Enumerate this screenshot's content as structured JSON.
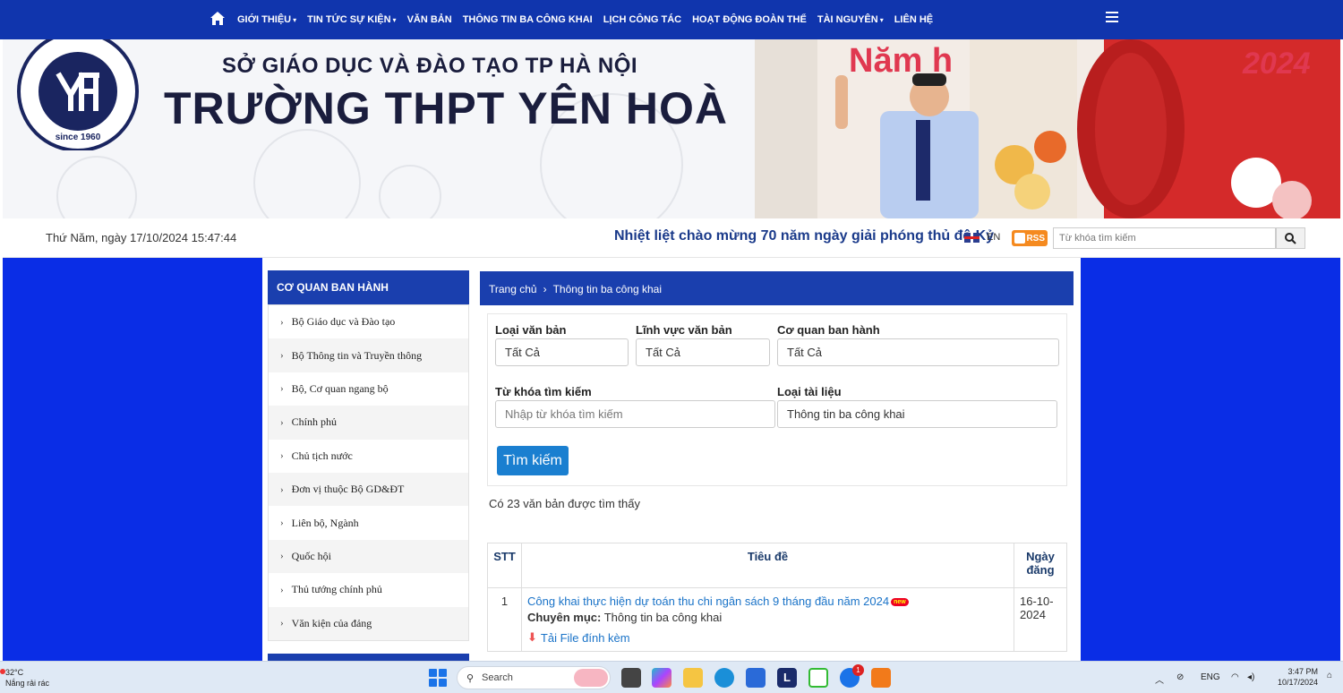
{
  "nav": {
    "items": [
      {
        "label": "GIỚI THIỆU",
        "dropdown": true
      },
      {
        "label": "TIN TỨC SỰ KIỆN",
        "dropdown": true
      },
      {
        "label": "VĂN BẢN",
        "dropdown": false
      },
      {
        "label": "THÔNG TIN BA CÔNG KHAI",
        "dropdown": false
      },
      {
        "label": "LỊCH CÔNG TÁC",
        "dropdown": false
      },
      {
        "label": "HOẠT ĐỘNG ĐOÀN THỂ",
        "dropdown": false
      },
      {
        "label": "TÀI NGUYÊN",
        "dropdown": true
      },
      {
        "label": "LIÊN HỆ",
        "dropdown": false
      }
    ]
  },
  "banner": {
    "subtitle": "SỞ GIÁO DỤC VÀ ĐÀO TẠO TP HÀ NỘI",
    "title": "TRƯỜNG THPT YÊN HOÀ",
    "logo_text": "TRƯỜNG THPT YÊN HOÀ",
    "logo_since": "since 1960",
    "photo_caption": "Năm học",
    "photo_year": "2024"
  },
  "infobar": {
    "datetime": "Thứ Năm, ngày 17/10/2024 15:47:44",
    "marquee": "Nhiệt liệt chào mừng 70 năm ngày giải phóng thủ đô Kỷ",
    "lang": "EN",
    "rss": "RSS",
    "search_placeholder": "Từ khóa tìm kiếm"
  },
  "sidebar": {
    "title": "CƠ QUAN BAN HÀNH",
    "items": [
      "Bộ Giáo dục và Đào tạo",
      "Bộ Thông tin và Truyền thông",
      "Bộ, Cơ quan ngang bộ",
      "Chính phủ",
      "Chủ tịch nước",
      "Đơn vị thuộc Bộ GD&ĐT",
      "Liên bộ, Ngành",
      "Quốc hội",
      "Thủ tướng chính phủ",
      "Văn kiện của đảng"
    ]
  },
  "breadcrumb": {
    "home": "Trang chủ",
    "current": "Thông tin ba công khai"
  },
  "filter": {
    "doc_type_label": "Loại văn bản",
    "doc_type_value": "Tất Cả",
    "field_label": "Lĩnh vực văn bản",
    "field_value": "Tất Cả",
    "agency_label": "Cơ quan ban hành",
    "agency_value": "Tất Cả",
    "keyword_label": "Từ khóa tìm kiếm",
    "keyword_placeholder": "Nhập từ khóa tìm kiếm",
    "material_label": "Loại tài liệu",
    "material_value": "Thông tin ba công khai",
    "search_button": "Tìm kiếm"
  },
  "results": {
    "count_text": "Có 23 văn bản được tìm thấy",
    "headers": {
      "stt": "STT",
      "title": "Tiêu đề",
      "date": "Ngày đăng"
    },
    "rows": [
      {
        "stt": "1",
        "title": "Công khai thực hiện dự toán thu chi ngân sách 9 tháng đầu năm 2024",
        "badge": "new",
        "category_label": "Chuyên mục:",
        "category_value": "Thông tin ba công khai",
        "download": "Tải File đính kèm",
        "date": "16-10-2024"
      }
    ]
  },
  "taskbar": {
    "temp": "32°C",
    "weather": "Nắng rải rác",
    "search": "Search",
    "badge": "1",
    "lang": "ENG",
    "time": "3:47 PM",
    "date": "10/17/2024"
  },
  "colors": {
    "nav": "#1035ad",
    "page_bg": "#0a2de6",
    "accent": "#1a3fae"
  }
}
